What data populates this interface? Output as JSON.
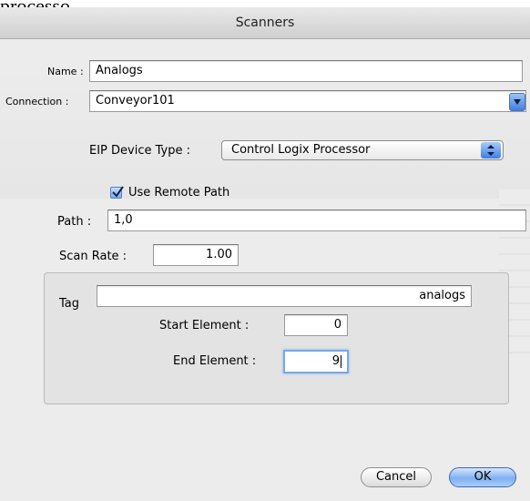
{
  "window": {
    "title": "Scanners",
    "background_text": "processo"
  },
  "form": {
    "name_label": "Name :",
    "name_value": "Analogs",
    "connection_label": "Connection :",
    "connection_value": "Conveyor101",
    "eip_label": "EIP Device Type :",
    "eip_value": "Control Logix Processor",
    "use_remote_path_label": "Use Remote Path",
    "use_remote_path_checked": true,
    "path_label": "Path :",
    "path_value": "1,0",
    "scan_rate_label": "Scan Rate :",
    "scan_rate_value": "1.00"
  },
  "group": {
    "tag_label": "Tag",
    "tag_value": "analogs",
    "start_label": "Start Element :",
    "start_value": "0",
    "end_label": "End Element :",
    "end_value": "9"
  },
  "buttons": {
    "cancel": "Cancel",
    "ok": "OK"
  },
  "colors": {
    "accent": "#3f7fe0",
    "focus_ring": "#7aa7e6",
    "dialog_bg": "#ececec"
  }
}
